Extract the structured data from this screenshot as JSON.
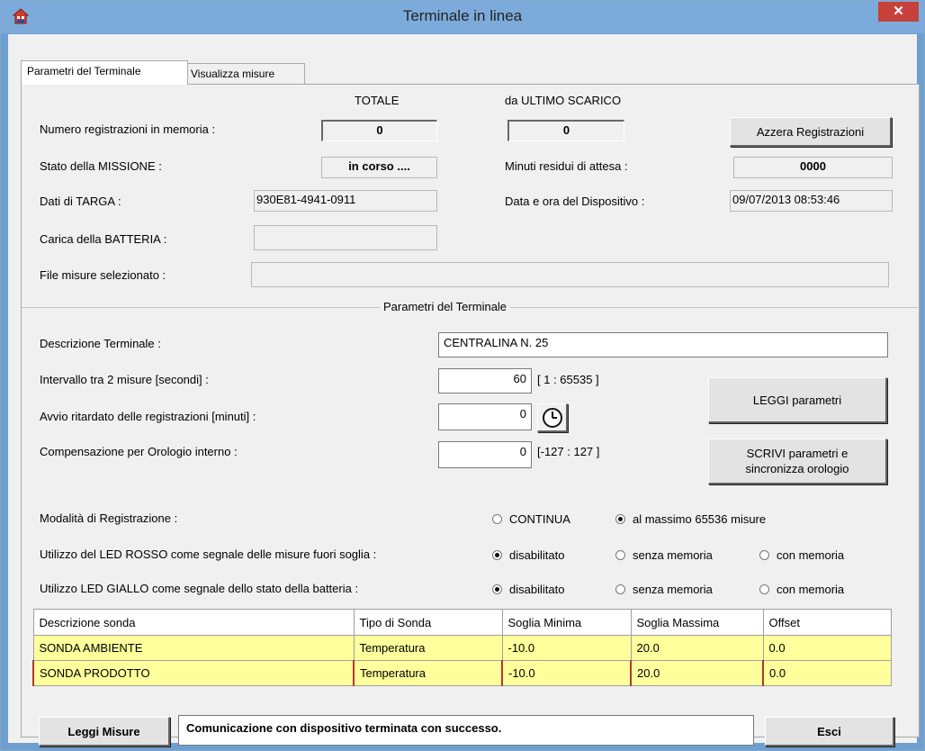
{
  "window": {
    "title": "Terminale in linea",
    "close_symbol": "✕"
  },
  "tabs": [
    {
      "label": "Parametri del Terminale"
    },
    {
      "label": "Visualizza misure"
    }
  ],
  "headers": {
    "totale": "TOTALE",
    "ultimo_scarico": "da ULTIMO SCARICO"
  },
  "info": {
    "num_registrazioni_label": "Numero registrazioni in memoria :",
    "num_registrazioni_totale": "0",
    "num_registrazioni_ultimo": "0",
    "azzera_button": "Azzera Registrazioni",
    "stato_missione_label": "Stato della MISSIONE :",
    "stato_missione_value": "in corso ....",
    "minuti_residui_label": "Minuti residui di attesa :",
    "minuti_residui_value": "0000",
    "dati_targa_label": "Dati di TARGA :",
    "dati_targa_value": "930E81-4941-0911",
    "data_ora_label": "Data e ora del Dispositivo :",
    "data_ora_value": "09/07/2013  08:53:46",
    "carica_batteria_label": "Carica della BATTERIA :",
    "carica_batteria_value": "",
    "file_misure_label": "File misure selezionato :",
    "file_misure_value": ""
  },
  "parametri": {
    "group_title": "Parametri del Terminale",
    "descrizione_label": "Descrizione Terminale :",
    "descrizione_value": "CENTRALINA N. 25",
    "intervallo_label": "Intervallo tra 2 misure  [secondi] :",
    "intervallo_value": "60",
    "intervallo_range": "[ 1 : 65535 ]",
    "avvio_label": "Avvio ritardato delle registrazioni  [minuti] :",
    "avvio_value": "0",
    "compensazione_label": "Compensazione per Orologio interno :",
    "compensazione_value": "0",
    "compensazione_range": "[-127 : 127 ]",
    "leggi_button": "LEGGI parametri",
    "scrivi_button_line1": "SCRIVI parametri e",
    "scrivi_button_line2": "sincronizza orologio",
    "modalita_label": "Modalità di Registrazione :",
    "modalita_opt1": "CONTINUA",
    "modalita_opt2": "al massimo 65536 misure",
    "led_rosso_label": "Utilizzo del LED ROSSO come segnale delle misure fuori soglia :",
    "led_giallo_label": "Utilizzo LED GIALLO come segnale dello stato della batteria :",
    "opt_disabilitato": "disabilitato",
    "opt_senza": "senza memoria",
    "opt_con": "con memoria"
  },
  "table": {
    "columns": [
      "Descrizione sonda",
      "Tipo di Sonda",
      "Soglia Minima",
      "Soglia Massima",
      "Offset"
    ],
    "rows": [
      [
        "SONDA  AMBIENTE",
        "Temperatura",
        "-10.0",
        "20.0",
        "0.0"
      ],
      [
        "SONDA  PRODOTTO",
        "Temperatura",
        "-10.0",
        "20.0",
        "0.0"
      ]
    ]
  },
  "footer": {
    "leggi_misure": "Leggi Misure",
    "status": "Comunicazione con dispositivo terminata con successo.",
    "esci": "Esci"
  }
}
